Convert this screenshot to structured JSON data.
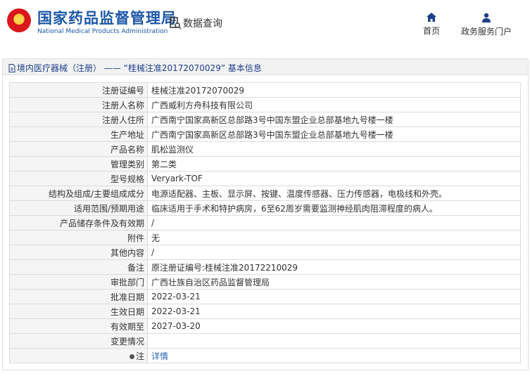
{
  "header": {
    "site_name": "国家药品监督管理局",
    "site_name_en": "National Medical Products Administration",
    "query_label": "数据查询",
    "nav": [
      {
        "label": "首页",
        "icon": "home-icon"
      },
      {
        "label": "政务服务门户",
        "icon": "user-icon"
      }
    ]
  },
  "breadcrumb": "境内医疗器械（注册） —— “桂械注准20172070029” 基本信息",
  "rows": [
    {
      "key": "注册证编号",
      "value": "桂械注准20172070029"
    },
    {
      "key": "注册人名称",
      "value": "广西威利方舟科技有限公司"
    },
    {
      "key": "注册人住所",
      "value": "广西南宁国家高新区总部路3号中国东盟企业总部基地九号楼一楼"
    },
    {
      "key": "生产地址",
      "value": "广西南宁国家高新区总部路3号中国东盟企业总部基地九号楼一楼"
    },
    {
      "key": "产品名称",
      "value": "肌松监测仪"
    },
    {
      "key": "管理类别",
      "value": "第二类"
    },
    {
      "key": "型号规格",
      "value": "Veryark-TOF"
    },
    {
      "key": "结构及组成/主要组成成分",
      "value": "电源适配器、主板、显示屏、按键、温度传感器、压力传感器，电极线和外壳。"
    },
    {
      "key": "适用范围/预期用途",
      "value": "临床适用于手术和特护病房，6至62周岁需要监测神经肌肉阻滞程度的病人。"
    },
    {
      "key": "产品储存条件及有效期",
      "value": "/"
    },
    {
      "key": "附件",
      "value": "无"
    },
    {
      "key": "其他内容",
      "value": "/"
    },
    {
      "key": "备注",
      "value": "原注册证编号:桂械注准20172210029"
    },
    {
      "key": "审批部门",
      "value": "广西壮族自治区药品监督管理局"
    },
    {
      "key": "批准日期",
      "value": "2022-03-21"
    },
    {
      "key": "生效日期",
      "value": "2022-03-21"
    },
    {
      "key": "有效期至",
      "value": "2027-03-20"
    },
    {
      "key": "变更情况",
      "value": ""
    },
    {
      "key": "注",
      "value": "详情"
    }
  ]
}
